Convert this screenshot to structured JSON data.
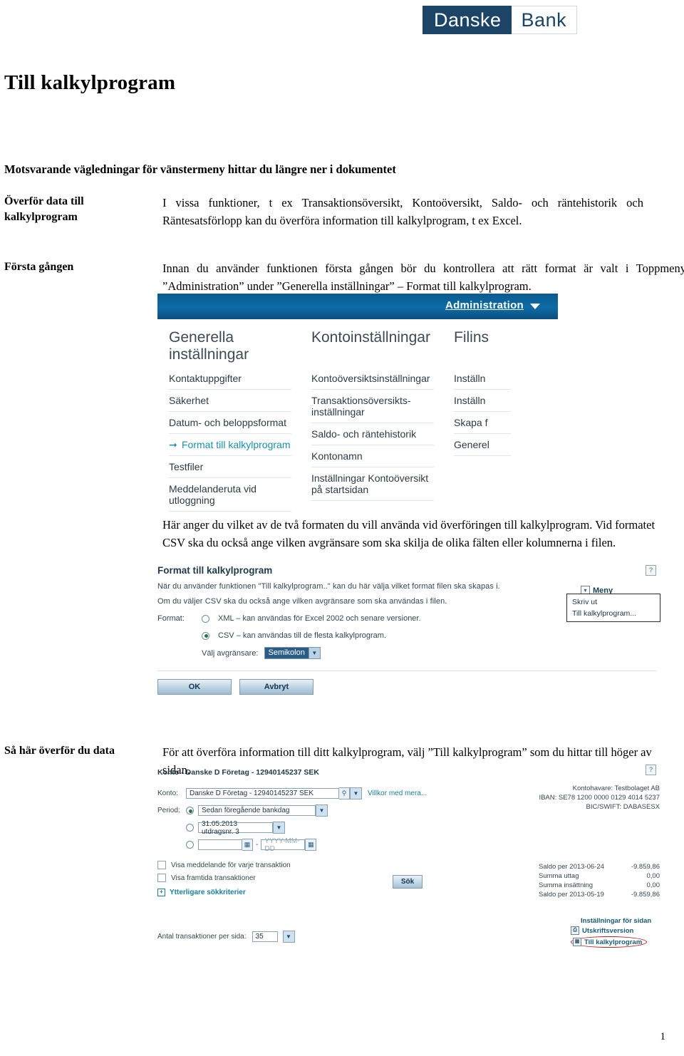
{
  "logo": {
    "dark_text": "Danske",
    "light_text": "Bank",
    "dark_color": "#1c4466"
  },
  "document": {
    "title": "Till kalkylprogram",
    "subtitle": "Motsvarande vägledningar för vänstermeny hittar du längre ner i dokumentet",
    "page_number": "1"
  },
  "sections": [
    {
      "label": "Överför data till\nkalkylprogram",
      "label_line1": "Överför data till",
      "label_line2": "kalkylprogram",
      "body": "I vissa funktioner, t ex Transaktionsöversikt, Kontoöversikt, Saldo- och räntehistorik och Räntesatsförlopp kan du överföra information till kalkylprogram, t ex Excel."
    },
    {
      "label": "Första gången",
      "body": "Innan du använder funktionen första gången bör du kontrollera att rätt format är valt i Toppmeny ”Administration” under ”Generella inställningar” – Format till kalkylprogram."
    },
    {
      "label": "Så här överför du data",
      "body": "För att överföra information till ditt kalkylprogram, välj ”Till kalkylprogram” som du hittar till höger av sidan."
    }
  ],
  "mid_paragraph": "Här anger du vilket av de två formaten du vill använda vid överföringen till kalkylprogram. Vid formatet CSV ska du också ange vilken avgränsare som ska skilja de olika fälten eller kolumnerna i filen.",
  "admin_screenshot": {
    "top_bar_label": "Administration",
    "columns": [
      {
        "heading": "Generella inställningar",
        "items": [
          {
            "label": "Kontaktuppgifter",
            "active": false
          },
          {
            "label": "Säkerhet",
            "active": false
          },
          {
            "label": "Datum- och beloppsformat",
            "active": false
          },
          {
            "label": "Format till kalkylprogram",
            "active": true
          },
          {
            "label": "Testfiler",
            "active": false
          },
          {
            "label": "Meddelanderuta vid utloggning",
            "active": false
          }
        ]
      },
      {
        "heading": "Kontoinställningar",
        "items": [
          {
            "label": "Kontoöversiktsinställningar",
            "active": false
          },
          {
            "label": "Transaktionsöversikts-inställningar",
            "active": false
          },
          {
            "label": "Saldo- och räntehistorik",
            "active": false
          },
          {
            "label": "Kontonamn",
            "active": false
          },
          {
            "label": "Inställningar Kontoöversikt på startsidan",
            "active": false
          }
        ]
      },
      {
        "heading": "Filins",
        "items": [
          {
            "label": "Inställn",
            "active": false
          },
          {
            "label": "Inställn",
            "active": false
          },
          {
            "label": "Skapa f",
            "active": false
          },
          {
            "label": "Generel",
            "active": false
          }
        ]
      }
    ]
  },
  "format_dialog": {
    "title": "Format till kalkylprogram",
    "help_icon": "?",
    "paragraph1": "När du använder funktionen \"Till kalkylprogram..\" kan du här välja vilket format filen ska skapas i.",
    "paragraph2": "Om du väljer CSV ska du också ange vilken avgränsare som ska användas i filen.",
    "format_label": "Format:",
    "option_xml": "XML – kan användas för Excel 2002 och senare versioner.",
    "option_csv": "CSV – kan användas till de flesta kalkylprogram.",
    "selected_option": "csv",
    "delimiter_label": "Välj avgränsare:",
    "delimiter_value": "Semikolon",
    "ok_button": "OK",
    "cancel_button": "Avbryt"
  },
  "meny_popup": {
    "menu_label": "Meny",
    "items": [
      "Skriv ut",
      "Till kalkylprogram..."
    ]
  },
  "transaction_screenshot": {
    "header": "Konto - Danske D Företag - 12940145237 SEK",
    "help_icon": "?",
    "konto_label": "Konto:",
    "konto_value": "Danske D Företag - 12940145237 SEK",
    "villkor_link": "Villkor med mera...",
    "period_label": "Period:",
    "period_option1": "Sedan föregående bankdag",
    "period_option2": "31.05.2013 utdragsnr. 3",
    "period_option3_from": "",
    "period_option3_to": "YYYY-MM-DD",
    "selected_period": "option1",
    "checkbox1": "Visa meddelande för varje transaktion",
    "checkbox2": "Visa framtida transaktioner",
    "expand_link": "Ytterligare sökkriterier",
    "search_button": "Sök",
    "account_info": [
      "Kontohavare: Testbolaget AB",
      "IBAN: SE78 1200 0000 0129 4014 5237",
      "BIC/SWIFT: DABASESX"
    ],
    "saldo_rows": [
      {
        "label": "Saldo per 2013-06-24",
        "value": "-9.859,86"
      },
      {
        "label": "Summa uttag",
        "value": "0,00"
      },
      {
        "label": "Summa insättning",
        "value": "0,00"
      },
      {
        "label": "Saldo per 2013-05-19",
        "value": "-9.859,86"
      }
    ],
    "footer_links": [
      {
        "label": "Inställningar för sidan",
        "icon": false,
        "highlighted": false
      },
      {
        "label": "Utskriftsversion",
        "icon": true,
        "highlighted": false
      },
      {
        "label": "Till kalkylprogram",
        "icon": true,
        "highlighted": true
      }
    ],
    "per_page_label": "Antal transaktioner per sida:",
    "per_page_value": "35"
  }
}
